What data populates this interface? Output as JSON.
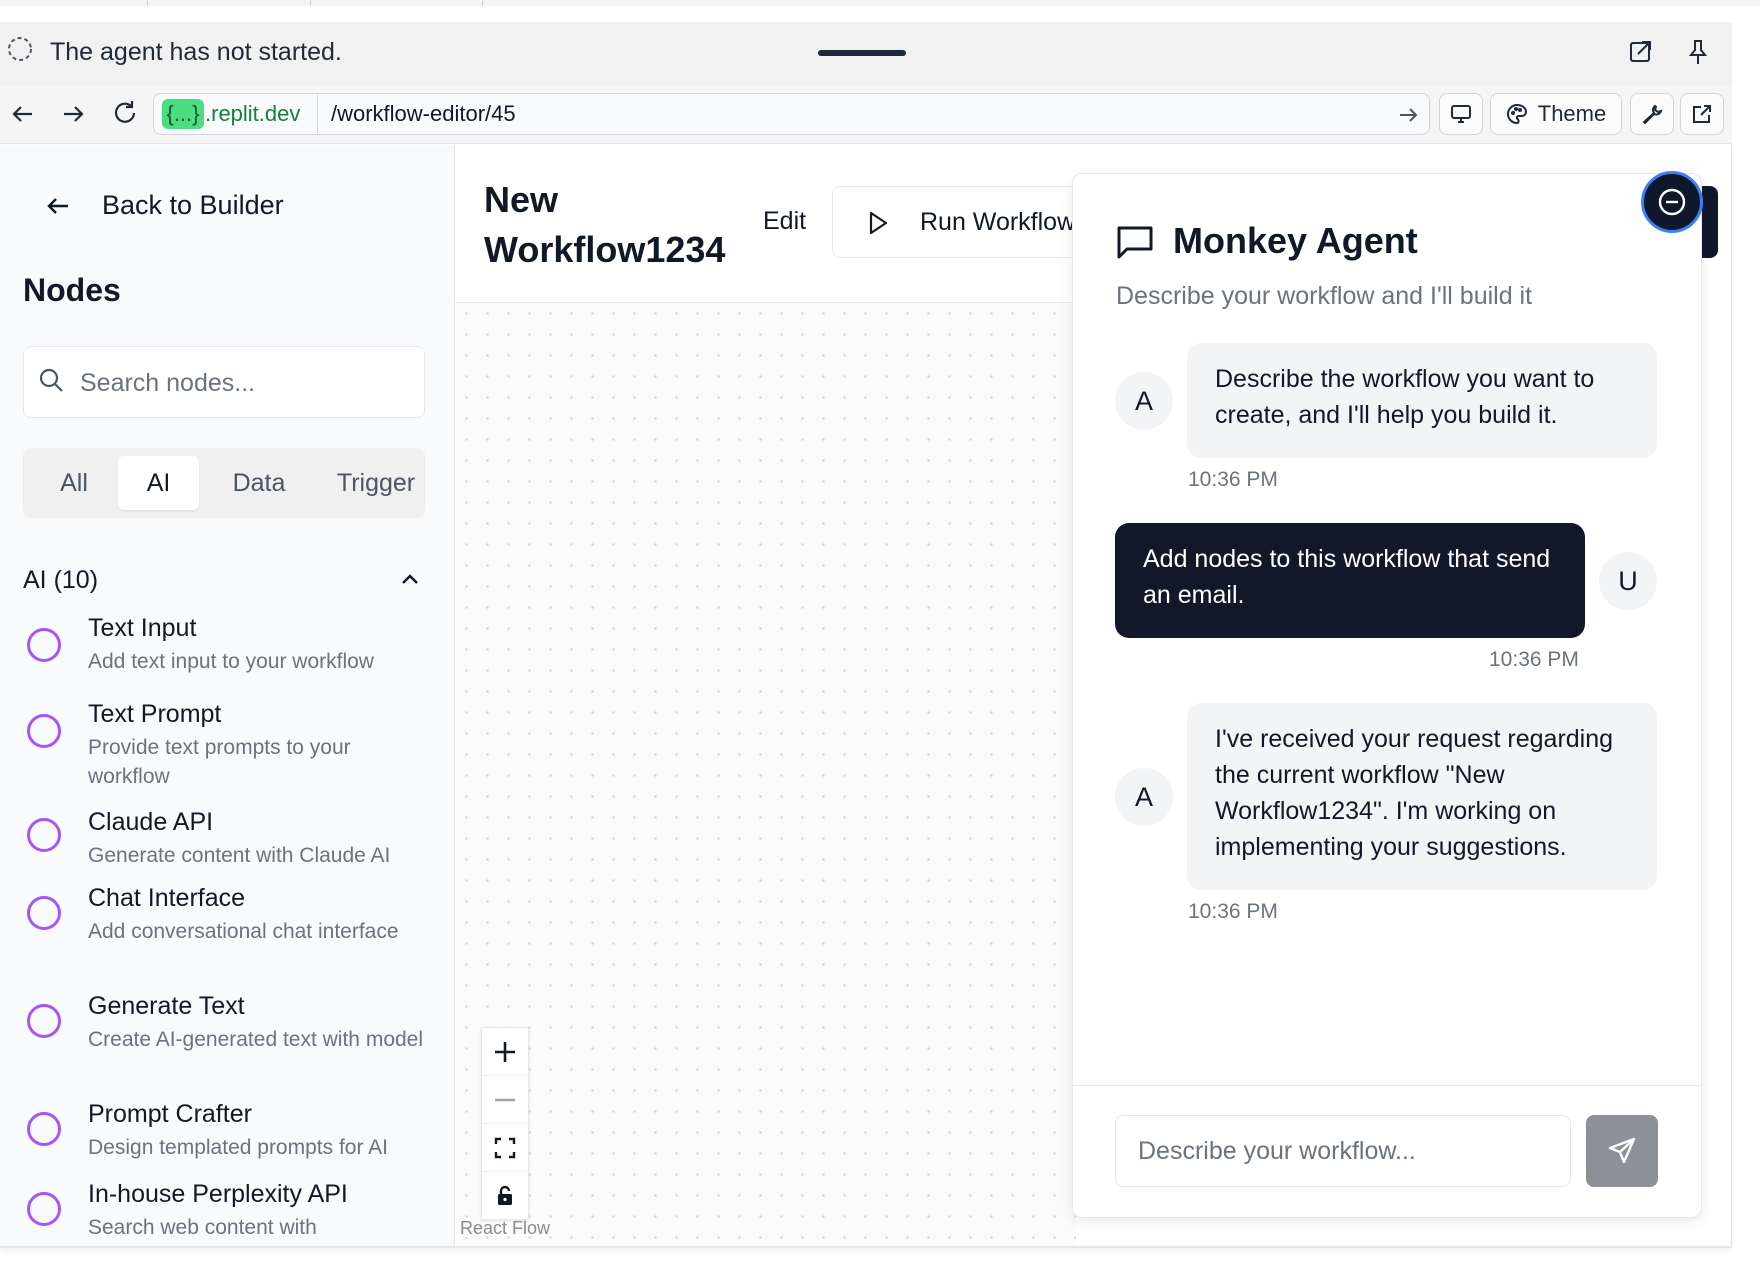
{
  "agent_bar": {
    "status": "The agent has not started."
  },
  "browser": {
    "host_badge": "{...}",
    "host": ".replit.dev",
    "path": "/workflow-editor/45",
    "theme_label": "Theme"
  },
  "sidebar": {
    "back_label": "Back to Builder",
    "title": "Nodes",
    "search_placeholder": "Search nodes...",
    "tabs": [
      {
        "label": "All"
      },
      {
        "label": "AI"
      },
      {
        "label": "Data"
      },
      {
        "label": "Trigger"
      }
    ],
    "active_tab": "AI",
    "category": "AI (10)",
    "nodes": [
      {
        "title": "Text Input",
        "desc": "Add text input to your workflow"
      },
      {
        "title": "Text Prompt",
        "desc": "Provide text prompts to your workflow"
      },
      {
        "title": "Claude API",
        "desc": "Generate content with Claude AI"
      },
      {
        "title": "Chat Interface",
        "desc": "Add conversational chat interface"
      },
      {
        "title": "Generate Text",
        "desc": "Create AI-generated text with model"
      },
      {
        "title": "Prompt Crafter",
        "desc": "Design templated prompts for AI"
      },
      {
        "title": "In-house Perplexity API",
        "desc": "Search web content with"
      }
    ]
  },
  "workflow": {
    "title": "New Workflow1234",
    "edit_label": "Edit",
    "run_label": "Run Workflow"
  },
  "canvas": {
    "attribution": "React Flow"
  },
  "chat": {
    "title": "Monkey Agent",
    "subtitle": "Describe your workflow and I'll build it",
    "messages": [
      {
        "role": "agent",
        "avatar": "A",
        "text": "Describe the workflow you want to create, and I'll help you build it.",
        "time": "10:36 PM"
      },
      {
        "role": "user",
        "avatar": "U",
        "text": "Add nodes to this workflow that send an email.",
        "time": "10:36 PM"
      },
      {
        "role": "agent",
        "avatar": "A",
        "text": "I've received your request regarding the current workflow \"New Workflow1234\". I'm working on implementing your suggestions.",
        "time": "10:36 PM"
      }
    ],
    "input_placeholder": "Describe your workflow..."
  },
  "colors": {
    "accent_node": "#a855f7",
    "user_bubble": "#111827",
    "agent_bubble": "#f3f4f6",
    "host_badge": "#4ade80",
    "send_button": "#8b9099"
  }
}
